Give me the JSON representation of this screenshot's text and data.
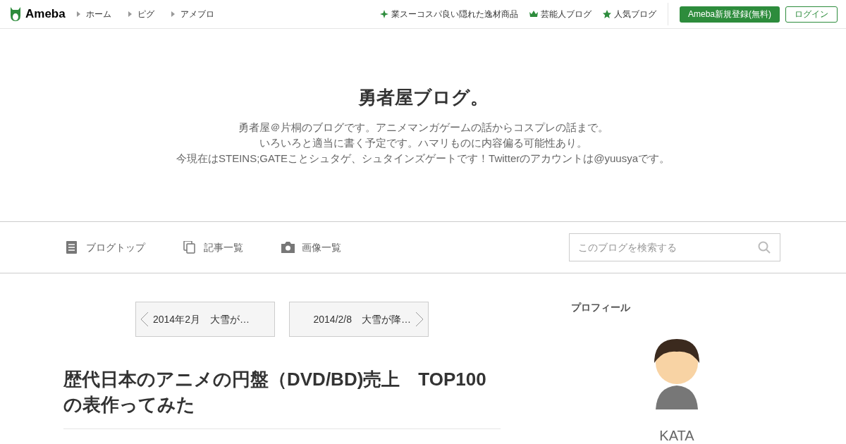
{
  "header": {
    "logo": "Ameba",
    "nav": [
      "ホーム",
      "ピグ",
      "アメブロ"
    ],
    "links": [
      {
        "kind": "sparkle",
        "label": "業スーコスパ良い隠れた逸材商品"
      },
      {
        "kind": "crown",
        "label": "芸能人ブログ"
      },
      {
        "kind": "star",
        "label": "人気ブログ"
      }
    ],
    "register_button": "Ameba新規登録(無料)",
    "login_button": "ログイン"
  },
  "blog": {
    "title": "勇者屋ブログ。",
    "description": [
      "勇者屋＠片桐のブログです。アニメマンガゲームの話からコスプレの話まで。",
      "いろいろと適当に書く予定です。ハマリものに内容偏る可能性あり。",
      "今現在はSTEINS;GATEことシュタゲ、シュタインズゲートです！Twitterのアカウントは@yuusyaです。"
    ]
  },
  "blog_nav": [
    {
      "kind": "document",
      "label": "ブログトップ"
    },
    {
      "kind": "copy",
      "label": "記事一覧"
    },
    {
      "kind": "camera",
      "label": "画像一覧"
    }
  ],
  "search": {
    "placeholder": "このブログを検索する"
  },
  "pager": {
    "previous": "2014年2月　大雪が…",
    "next": "2014/2/8　大雪が降…"
  },
  "article": {
    "title": "歴代日本のアニメの円盤（DVD/BD)売上　TOP100の表作ってみた"
  },
  "profile": {
    "heading": "プロフィール",
    "name": "KATA"
  }
}
